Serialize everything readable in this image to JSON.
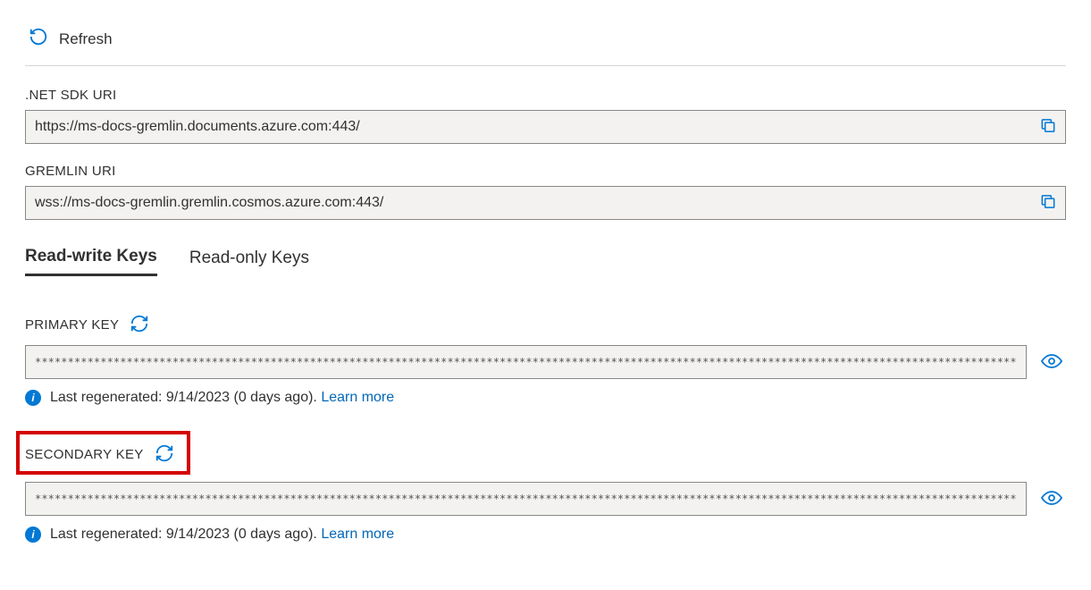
{
  "toolbar": {
    "refresh_label": "Refresh"
  },
  "fields": {
    "net_sdk_uri": {
      "label": ".NET SDK URI",
      "value": "https://ms-docs-gremlin.documents.azure.com:443/"
    },
    "gremlin_uri": {
      "label": "GREMLIN URI",
      "value": "wss://ms-docs-gremlin.gremlin.cosmos.azure.com:443/"
    }
  },
  "tabs": {
    "read_write": "Read-write Keys",
    "read_only": "Read-only Keys"
  },
  "keys": {
    "primary": {
      "label": "PRIMARY KEY",
      "value": "****************************************************************************************************************************************************************",
      "info_prefix": "Last regenerated: 9/14/2023 (0 days ago). ",
      "learn_more": "Learn more"
    },
    "secondary": {
      "label": "SECONDARY KEY",
      "value": "****************************************************************************************************************************************************************",
      "info_prefix": "Last regenerated: 9/14/2023 (0 days ago). ",
      "learn_more": "Learn more"
    }
  }
}
